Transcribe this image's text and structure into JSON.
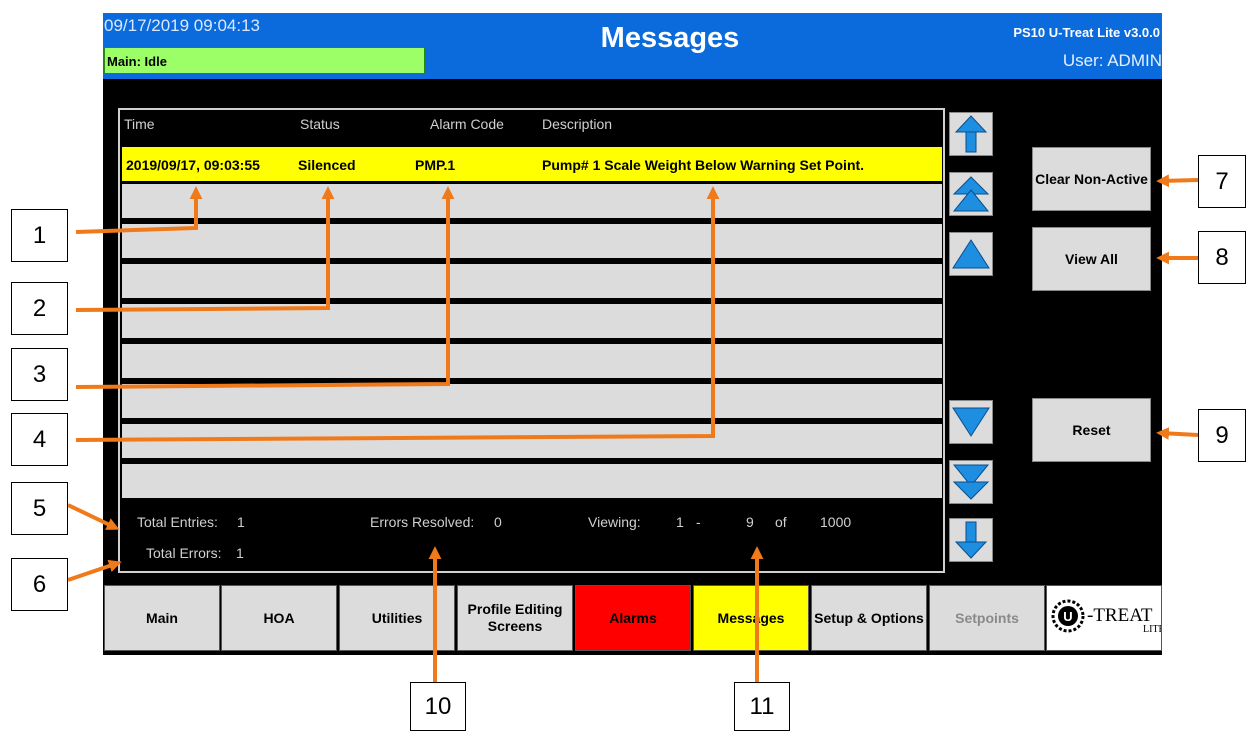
{
  "header": {
    "datetime": "09/17/2019 09:04:13",
    "status": "Main: Idle",
    "title": "Messages",
    "version": "PS10 U-Treat Lite v3.0.0",
    "user": "User: ADMIN"
  },
  "table": {
    "columns": [
      "Time",
      "Status",
      "Alarm Code",
      "Description"
    ],
    "rows": [
      {
        "time": "2019/09/17, 09:03:55",
        "status": "Silenced",
        "code": "PMP.1",
        "description": "Pump# 1 Scale Weight Below Warning Set Point."
      }
    ]
  },
  "footer": {
    "total_entries_label": "Total Entries:",
    "total_entries": "1",
    "total_errors_label": "Total Errors:",
    "total_errors": "1",
    "resolved_label": "Errors Resolved:",
    "resolved": "0",
    "viewing_label": "Viewing:",
    "view_from": "1",
    "view_dash": "-",
    "view_to": "9",
    "of_label": "of",
    "view_total": "1000"
  },
  "buttons": {
    "clear": "Clear Non-Active",
    "view_all": "View All",
    "reset": "Reset"
  },
  "nav": [
    "Main",
    "HOA",
    "Utilities",
    "Profile Editing Screens",
    "Alarms",
    "Messages",
    "Setup & Options",
    "Setpoints"
  ],
  "logo": "TREAT LITE",
  "callouts": [
    "1",
    "2",
    "3",
    "4",
    "5",
    "6",
    "7",
    "8",
    "9",
    "10",
    "11"
  ],
  "colors": {
    "header": "#0b6bdc",
    "status_idle": "#9cff68",
    "active_row": "#ffff00",
    "alarms_tab": "#ff0000",
    "messages_tab": "#ffff00",
    "callout_arrow": "#f07a1a"
  },
  "icons": [
    "arrow-top-icon",
    "page-up-icon",
    "line-up-icon",
    "line-down-icon",
    "page-down-icon",
    "arrow-bottom-icon"
  ]
}
